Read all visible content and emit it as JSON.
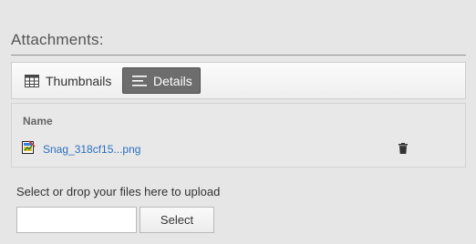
{
  "attachments": {
    "title": "Attachments:"
  },
  "view_toggle": {
    "thumbnails_label": "Thumbnails",
    "details_label": "Details",
    "active": "Details",
    "thumbnails_icon": "grid-icon",
    "details_icon": "list-icon"
  },
  "file_list": {
    "column_header": "Name",
    "files": [
      {
        "name": "Snag_318cf15...png",
        "icon": "image-file-icon",
        "action_icon": "trash-icon"
      }
    ]
  },
  "upload": {
    "label": "Select or drop your files here to upload",
    "input_value": "",
    "select_label": "Select"
  },
  "colors": {
    "background": "#e6e6e6",
    "active_button": "#6d6d6d",
    "link": "#2a6fbf",
    "title_text": "#555555"
  }
}
